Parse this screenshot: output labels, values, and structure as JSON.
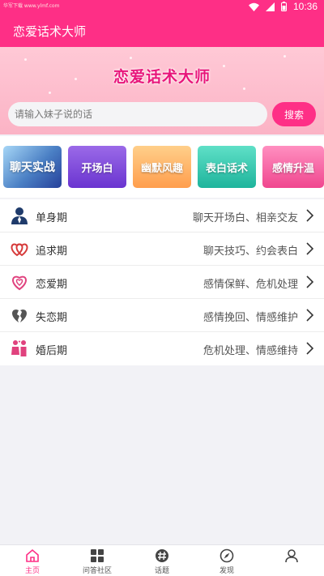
{
  "status_bar": {
    "carrier": "华军下载 www.ylmf.com",
    "time": "10:36"
  },
  "app_bar": {
    "title": "恋爱话术大师"
  },
  "hero": {
    "brand": "恋爱话术大师"
  },
  "search": {
    "placeholder": "请输入妹子说的话",
    "button_label": "搜索"
  },
  "categories": [
    {
      "label": "聊天实战"
    },
    {
      "label": "开场白"
    },
    {
      "label": "幽默风趣"
    },
    {
      "label": "表白话术"
    },
    {
      "label": "感情升温"
    }
  ],
  "stages": [
    {
      "name": "单身期",
      "desc": "聊天开场白、相亲交友",
      "icon": "single-person-icon"
    },
    {
      "name": "追求期",
      "desc": "聊天技巧、约会表白",
      "icon": "double-heart-icon"
    },
    {
      "name": "恋爱期",
      "desc": "感情保鲜、危机处理",
      "icon": "heart-outline-icon"
    },
    {
      "name": "失恋期",
      "desc": "感情挽回、情感维护",
      "icon": "broken-heart-icon"
    },
    {
      "name": "婚后期",
      "desc": "危机处理、情感维持",
      "icon": "couple-icon"
    }
  ],
  "bottom_nav": [
    {
      "label": "主页",
      "icon": "home-icon",
      "active": true
    },
    {
      "label": "问答社区",
      "icon": "grid-icon",
      "active": false
    },
    {
      "label": "话题",
      "icon": "hashtag-icon",
      "active": false
    },
    {
      "label": "发现",
      "icon": "compass-icon",
      "active": false
    },
    {
      "label": "",
      "icon": "profile-icon",
      "active": false
    }
  ],
  "colors": {
    "primary": "#fe2f86",
    "hero_bg": "#fbb3c5",
    "brand_text": "#e8157a"
  }
}
